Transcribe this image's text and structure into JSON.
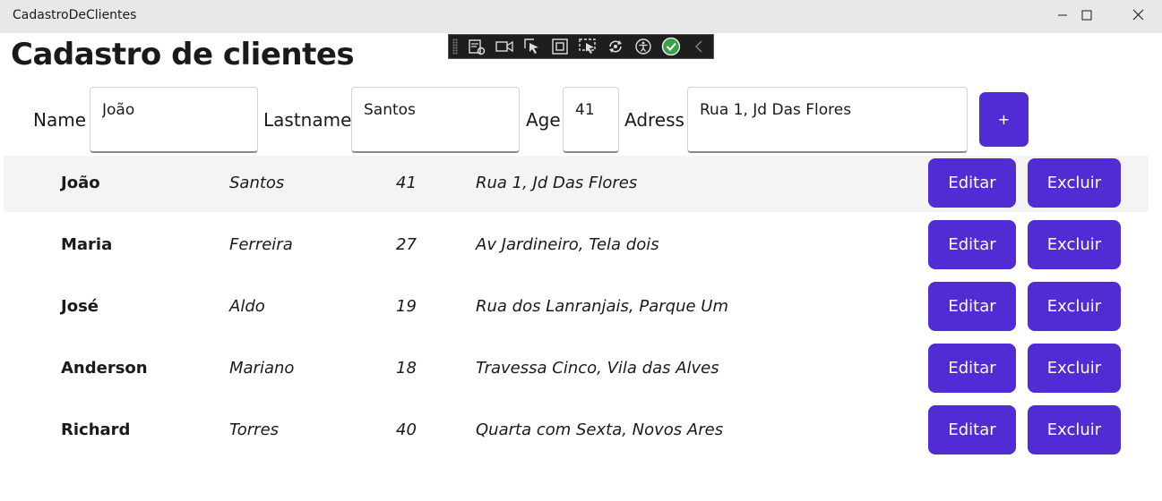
{
  "window": {
    "title": "CadastroDeClientes",
    "controls": {
      "minimize": "minimize-icon",
      "maximize": "maximize-icon",
      "close": "close-icon"
    }
  },
  "debug_toolbar": {
    "icons": [
      "live-visual-tree-icon",
      "record-icon",
      "select-element-icon",
      "display-adorners-icon",
      "track-focus-icon",
      "hot-reload-icon",
      "accessibility-icon",
      "check-icon",
      "collapse-icon"
    ]
  },
  "page": {
    "title": "Cadastro de clientes"
  },
  "form": {
    "name_label": "Name",
    "name_value": "João",
    "lastname_label": "Lastname",
    "lastname_value": "Santos",
    "age_label": "Age",
    "age_value": "41",
    "address_label": "Adress",
    "address_value": "Rua 1, Jd Das Flores",
    "add_label": "+"
  },
  "clients": [
    {
      "name": "João",
      "lastname": "Santos",
      "age": "41",
      "address": "Rua 1, Jd Das Flores",
      "edit": "Editar",
      "delete": "Excluir"
    },
    {
      "name": "Maria",
      "lastname": "Ferreira",
      "age": "27",
      "address": "Av Jardineiro, Tela dois",
      "edit": "Editar",
      "delete": "Excluir"
    },
    {
      "name": "José",
      "lastname": "Aldo",
      "age": "19",
      "address": "Rua dos Lanranjais, Parque Um",
      "edit": "Editar",
      "delete": "Excluir"
    },
    {
      "name": "Anderson",
      "lastname": "Mariano",
      "age": "18",
      "address": "Travessa Cinco, Vila das Alves",
      "edit": "Editar",
      "delete": "Excluir"
    },
    {
      "name": "Richard",
      "lastname": "Torres",
      "age": "40",
      "address": "Quarta com Sexta, Novos Ares",
      "edit": "Editar",
      "delete": "Excluir"
    }
  ],
  "colors": {
    "accent": "#512bd4",
    "titlebar": "#e8e8e8",
    "selected_row": "#f4f4f4",
    "toolbar": "#1e1e1e"
  }
}
